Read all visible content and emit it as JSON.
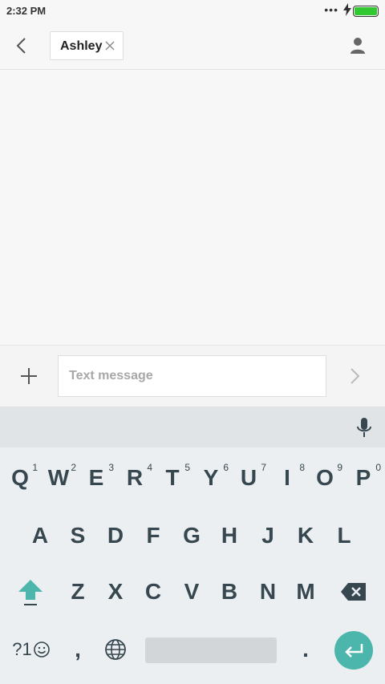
{
  "status": {
    "time": "2:32 PM",
    "dots": "•••"
  },
  "header": {
    "recipient": "Ashley"
  },
  "composer": {
    "placeholder": "Text message",
    "value": ""
  },
  "keyboard": {
    "row1": [
      {
        "label": "Q",
        "hint": "1"
      },
      {
        "label": "W",
        "hint": "2"
      },
      {
        "label": "E",
        "hint": "3"
      },
      {
        "label": "R",
        "hint": "4"
      },
      {
        "label": "T",
        "hint": "5"
      },
      {
        "label": "Y",
        "hint": "6"
      },
      {
        "label": "U",
        "hint": "7"
      },
      {
        "label": "I",
        "hint": "8"
      },
      {
        "label": "O",
        "hint": "9"
      },
      {
        "label": "P",
        "hint": "0"
      }
    ],
    "row2": [
      "A",
      "S",
      "D",
      "F",
      "G",
      "H",
      "J",
      "K",
      "L"
    ],
    "row3": [
      "Z",
      "X",
      "C",
      "V",
      "B",
      "N",
      "M"
    ],
    "symbols_label": "?1",
    "comma": ",",
    "period": "."
  },
  "colors": {
    "accent": "#4db6ac",
    "battery": "#32c832",
    "key_text": "#37474f"
  }
}
